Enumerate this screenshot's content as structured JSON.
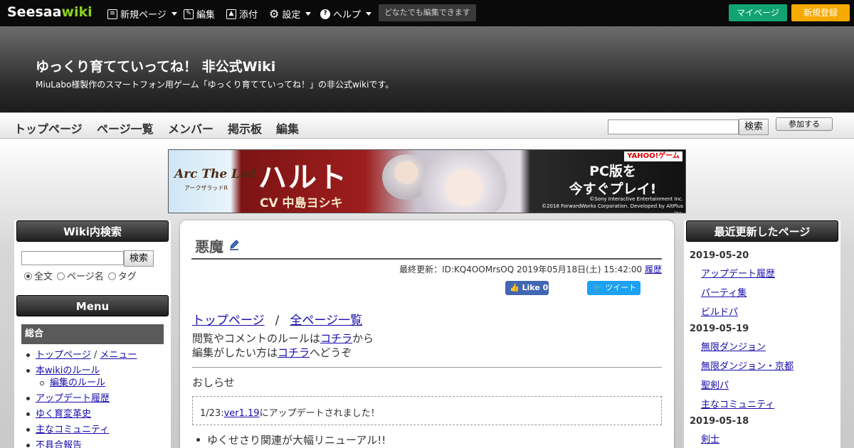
{
  "topbar": {
    "logo_part1": "Seesaa",
    "logo_part2": "wiki",
    "new_page": "新規ページ",
    "edit": "編集",
    "attach": "添付",
    "settings": "設定",
    "help": "ヘルプ",
    "note": "どなたでも編集できます",
    "mypage": "マイページ",
    "register": "新規登録"
  },
  "header": {
    "title": "ゆっくり育てていってね！ 非公式Wiki",
    "subtitle": "MiuLabo様製作のスマートフォン用ゲーム「ゆっくり育てていってね！」の非公式wikiです。"
  },
  "nav": {
    "items": [
      "トップページ",
      "ページ一覧",
      "メンバー",
      "掲示板",
      "編集"
    ],
    "search_button": "検索",
    "join_button": "参加する"
  },
  "banner": {
    "logo": "Arc The Lad",
    "logo_sub": "アークザラッドR",
    "name": "ハルト",
    "cv": "CV 中島ヨシキ",
    "yahoo": "YAHOO!ゲーム",
    "pc_line1": "PC版を",
    "pc_line2": "今すぐプレイ!",
    "copyright1": "©Sony Interactive Entertainment Inc.",
    "copyright2": "©2018 ForwardWorks Corporation. Developed by AltPlus Inc."
  },
  "left_sidebar": {
    "search_heading": "Wiki内検索",
    "search_button": "検索",
    "radio_options": [
      "全文",
      "ページ名",
      "タグ"
    ],
    "menu_heading": "Menu",
    "menu_category": "総合",
    "menu_items": [
      {
        "label": "トップページ",
        "extra": "メニュー"
      },
      {
        "label": "本wikiのルール"
      },
      {
        "label": "編集のルール",
        "sub": true
      },
      {
        "label": "アップデート履歴"
      },
      {
        "label": "ゆく育変革史"
      },
      {
        "label": "主なコミュニティ"
      },
      {
        "label": "不具合報告"
      }
    ]
  },
  "main": {
    "title": "悪魔",
    "updated_prefix": "最終更新：ID:KQ4OOMrsOQ 2019年05月18日(土) 15:42:00",
    "history": "履歴",
    "like": "Like 0",
    "tweet": "ツイート",
    "crumb_top": "トップページ",
    "crumb_sep": "/",
    "crumb_all": "全ページ一覧",
    "rule_line1_a": "閲覧やコメントのルールは",
    "rule_line1_link": "コチラ",
    "rule_line1_b": "から",
    "rule_line2_a": "編集がしたい方は",
    "rule_line2_link": "コチラ",
    "rule_line2_b": "へどうぞ",
    "oshirase": "おしらせ",
    "notice_a": "1/23:",
    "notice_link": "ver1.19",
    "notice_b": "にアップデートされました！",
    "bullet": "ゆくせさり関連が大幅リニューアル!!"
  },
  "right_sidebar": {
    "heading": "最近更新したページ",
    "groups": [
      {
        "date": "2019-05-20",
        "pages": [
          "アップデート履歴",
          "パーティ集",
          "ビルドパ"
        ]
      },
      {
        "date": "2019-05-19",
        "pages": [
          "無限ダンジョン",
          "無限ダンジョン・京都",
          "聖剣パ",
          "主なコミュニティ"
        ]
      },
      {
        "date": "2019-05-18",
        "pages": [
          "剣士"
        ]
      }
    ]
  }
}
